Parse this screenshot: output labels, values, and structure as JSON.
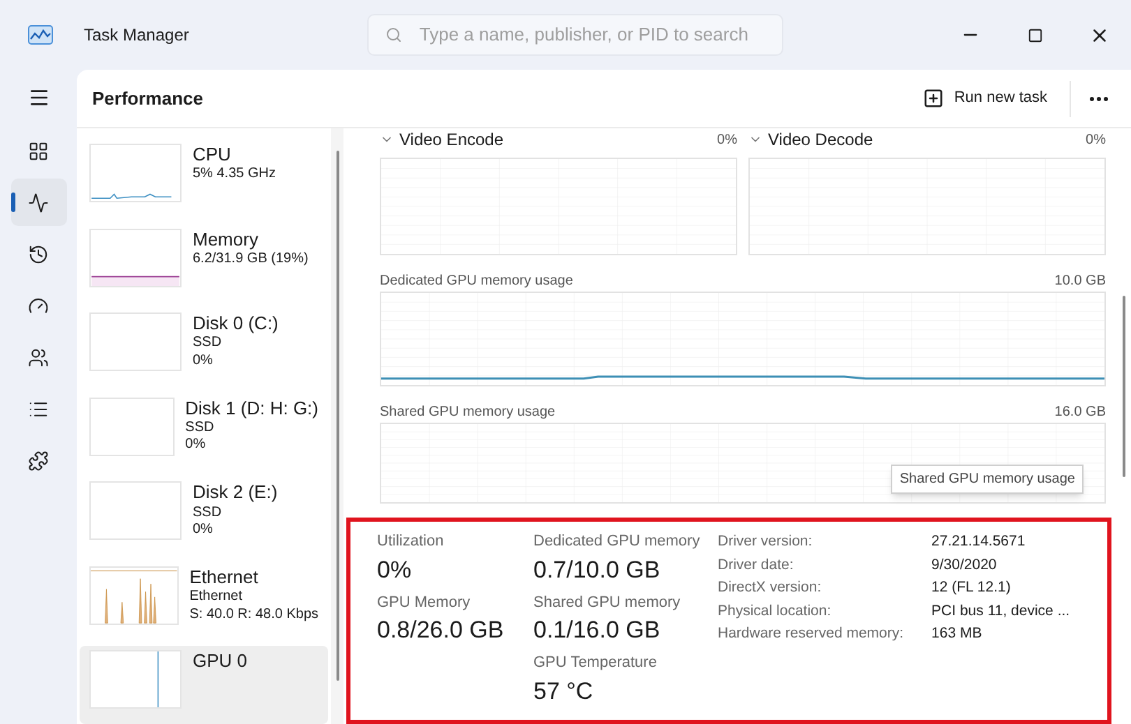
{
  "window": {
    "title": "Task Manager"
  },
  "search": {
    "placeholder": "Type a name, publisher, or PID to search"
  },
  "nav_items": [
    {
      "kind": "processes",
      "selected": false
    },
    {
      "kind": "performance",
      "selected": true
    },
    {
      "kind": "history",
      "selected": false
    },
    {
      "kind": "startup",
      "selected": false
    },
    {
      "kind": "users",
      "selected": false
    },
    {
      "kind": "details",
      "selected": false
    },
    {
      "kind": "services",
      "selected": false
    }
  ],
  "header": {
    "title": "Performance",
    "run_new_task": "Run new task"
  },
  "devices": [
    {
      "kind": "cpu",
      "name": "CPU",
      "lines": [
        "5% 4.35 GHz"
      ],
      "selected": false
    },
    {
      "kind": "memory",
      "name": "Memory",
      "lines": [
        "6.2/31.9 GB (19%)"
      ],
      "selected": false
    },
    {
      "kind": "disk",
      "name": "Disk 0 (C:)",
      "lines": [
        "SSD",
        "0%"
      ],
      "selected": false
    },
    {
      "kind": "disk",
      "name": "Disk 1 (D: H: G:)",
      "lines": [
        "SSD",
        "0%"
      ],
      "selected": false
    },
    {
      "kind": "disk",
      "name": "Disk 2 (E:)",
      "lines": [
        "SSD",
        "0%"
      ],
      "selected": false
    },
    {
      "kind": "ethernet",
      "name": "Ethernet",
      "lines": [
        "Ethernet",
        "S: 40.0 R: 48.0 Kbps"
      ],
      "selected": false
    },
    {
      "kind": "gpu",
      "name": "GPU 0",
      "selected": true
    }
  ],
  "engine_graphs": [
    {
      "title": "Video Encode",
      "value": "0%"
    },
    {
      "title": "Video Decode",
      "value": "0%"
    }
  ],
  "memory_graphs": [
    {
      "kind": "dedicated",
      "title": "Dedicated GPU memory usage",
      "max": "10.0 GB"
    },
    {
      "kind": "shared",
      "title": "Shared GPU memory usage",
      "max": "16.0 GB",
      "tooltip": "Shared GPU memory usage"
    }
  ],
  "stats": [
    [
      {
        "label": "Utilization",
        "value": "0%"
      },
      {
        "label": "GPU Memory",
        "value": "0.8/26.0 GB"
      }
    ],
    [
      {
        "label": "Dedicated GPU memory",
        "value": "0.7/10.0 GB"
      },
      {
        "label": "Shared GPU memory",
        "value": "0.1/16.0 GB"
      },
      {
        "label": "GPU Temperature",
        "value": "57 °C"
      }
    ]
  ],
  "properties": [
    {
      "label": "Driver version:",
      "value": "27.21.14.5671"
    },
    {
      "label": "Driver date:",
      "value": "9/30/2020"
    },
    {
      "label": "DirectX version:",
      "value": "12 (FL 12.1)"
    },
    {
      "label": "Physical location:",
      "value": "PCI bus 11, device ..."
    },
    {
      "label": "Hardware reserved memory:",
      "value": "163 MB"
    }
  ]
}
